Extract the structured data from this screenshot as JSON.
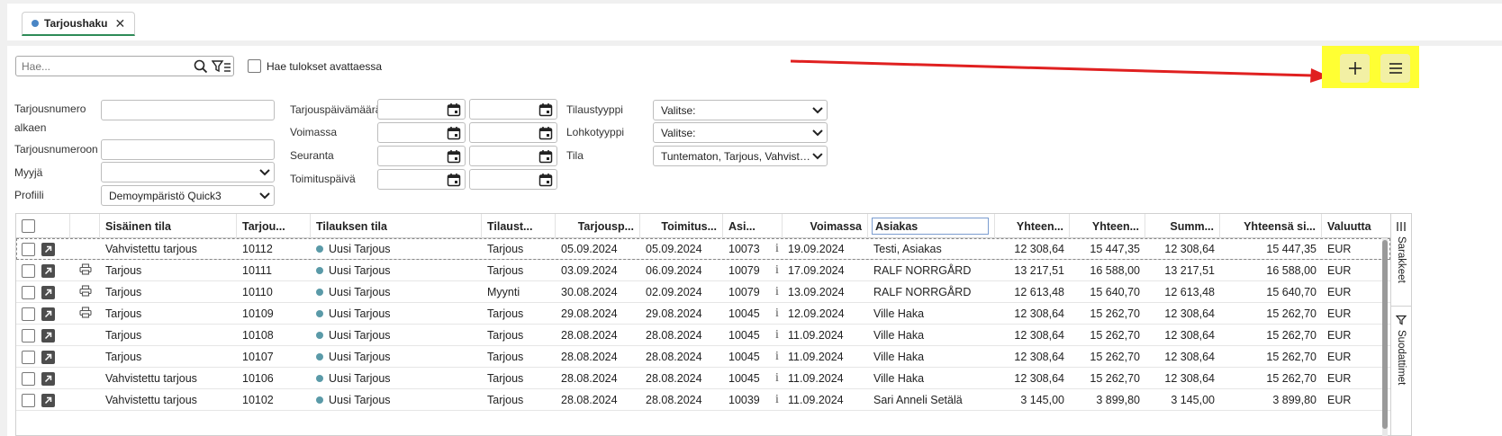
{
  "tab": {
    "label": "Tarjoushaku",
    "close": "✕"
  },
  "search": {
    "placeholder": "Hae...",
    "value": ""
  },
  "autoload_label": "Hae tulokset avattaessa",
  "filters": {
    "tarjousnumero_alkaen_1": "Tarjousnumero",
    "tarjousnumero_alkaen_2": "alkaen",
    "tarjousnumeroon": "Tarjousnumeroon",
    "myyja": "Myyjä",
    "profiili": "Profiili",
    "profiili_value": "Demoympäristö Quick3",
    "tarjouspaivamaara": "Tarjouspäivämäärä",
    "voimassa": "Voimassa",
    "seuranta": "Seuranta",
    "toimituspaiva": "Toimituspäivä",
    "tilaustyyppi": "Tilaustyyppi",
    "tilaustyyppi_value": "Valitse:",
    "lohkotyyppi": "Lohkotyyppi",
    "lohkotyyppi_value": "Valitse:",
    "tila": "Tila",
    "tila_value": "Tuntematon, Tarjous, Vahviste..."
  },
  "columns": [
    "Sisäinen tila",
    "Tarjou...",
    "Tilauksen tila",
    "Tilaust...",
    "Tarjousp...",
    "Toimitus...",
    "Asi...",
    "Voimassa",
    "Asiakas",
    "Yhteen...",
    "Yhteen...",
    "Summ...",
    "Yhteensä si...",
    "Valuutta"
  ],
  "rows": [
    {
      "sisainen": "Vahvistettu tarjous",
      "nro": "10112",
      "tila": "Uusi Tarjous",
      "tyyppi": "Tarjous",
      "tpvm": "05.09.2024",
      "toim": "05.09.2024",
      "asi": "10073",
      "voim": "19.09.2024",
      "asiakas": "Testi, Asiakas",
      "y1": "12 308,64",
      "y2": "15 447,35",
      "summ": "12 308,64",
      "ysi": "15 447,35",
      "val": "EUR",
      "print": false
    },
    {
      "sisainen": "Tarjous",
      "nro": "10111",
      "tila": "Uusi Tarjous",
      "tyyppi": "Tarjous",
      "tpvm": "03.09.2024",
      "toim": "06.09.2024",
      "asi": "10079",
      "voim": "17.09.2024",
      "asiakas": "RALF NORRGÅRD",
      "y1": "13 217,51",
      "y2": "16 588,00",
      "summ": "13 217,51",
      "ysi": "16 588,00",
      "val": "EUR",
      "print": true
    },
    {
      "sisainen": "Tarjous",
      "nro": "10110",
      "tila": "Uusi Tarjous",
      "tyyppi": "Myynti",
      "tpvm": "30.08.2024",
      "toim": "02.09.2024",
      "asi": "10079",
      "voim": "13.09.2024",
      "asiakas": "RALF NORRGÅRD",
      "y1": "12 613,48",
      "y2": "15 640,70",
      "summ": "12 613,48",
      "ysi": "15 640,70",
      "val": "EUR",
      "print": true
    },
    {
      "sisainen": "Tarjous",
      "nro": "10109",
      "tila": "Uusi Tarjous",
      "tyyppi": "Tarjous",
      "tpvm": "29.08.2024",
      "toim": "29.08.2024",
      "asi": "10045",
      "voim": "12.09.2024",
      "asiakas": "Ville Haka",
      "y1": "12 308,64",
      "y2": "15 262,70",
      "summ": "12 308,64",
      "ysi": "15 262,70",
      "val": "EUR",
      "print": true
    },
    {
      "sisainen": "Tarjous",
      "nro": "10108",
      "tila": "Uusi Tarjous",
      "tyyppi": "Tarjous",
      "tpvm": "28.08.2024",
      "toim": "28.08.2024",
      "asi": "10045",
      "voim": "11.09.2024",
      "asiakas": "Ville Haka",
      "y1": "12 308,64",
      "y2": "15 262,70",
      "summ": "12 308,64",
      "ysi": "15 262,70",
      "val": "EUR",
      "print": false
    },
    {
      "sisainen": "Tarjous",
      "nro": "10107",
      "tila": "Uusi Tarjous",
      "tyyppi": "Tarjous",
      "tpvm": "28.08.2024",
      "toim": "28.08.2024",
      "asi": "10045",
      "voim": "11.09.2024",
      "asiakas": "Ville Haka",
      "y1": "12 308,64",
      "y2": "15 262,70",
      "summ": "12 308,64",
      "ysi": "15 262,70",
      "val": "EUR",
      "print": false
    },
    {
      "sisainen": "Vahvistettu tarjous",
      "nro": "10106",
      "tila": "Uusi Tarjous",
      "tyyppi": "Tarjous",
      "tpvm": "28.08.2024",
      "toim": "28.08.2024",
      "asi": "10045",
      "voim": "11.09.2024",
      "asiakas": "Ville Haka",
      "y1": "12 308,64",
      "y2": "15 262,70",
      "summ": "12 308,64",
      "ysi": "15 262,70",
      "val": "EUR",
      "print": false
    },
    {
      "sisainen": "Vahvistettu tarjous",
      "nro": "10102",
      "tila": "Uusi Tarjous",
      "tyyppi": "Tarjous",
      "tpvm": "28.08.2024",
      "toim": "28.08.2024",
      "asi": "10039",
      "voim": "11.09.2024",
      "asiakas": "Sari Anneli Setälä",
      "y1": "3 145,00",
      "y2": "3 899,80",
      "summ": "3 145,00",
      "ysi": "3 899,80",
      "val": "EUR",
      "print": false
    }
  ],
  "info_glyph": "i",
  "side": {
    "columns": "Sarakkeet",
    "filters": "Suodattimet"
  },
  "colors": {
    "accent_green": "#2e8b57",
    "highlight": "#ffff33",
    "arrow": "#e02020",
    "status_dot": "#5a9aa8"
  }
}
